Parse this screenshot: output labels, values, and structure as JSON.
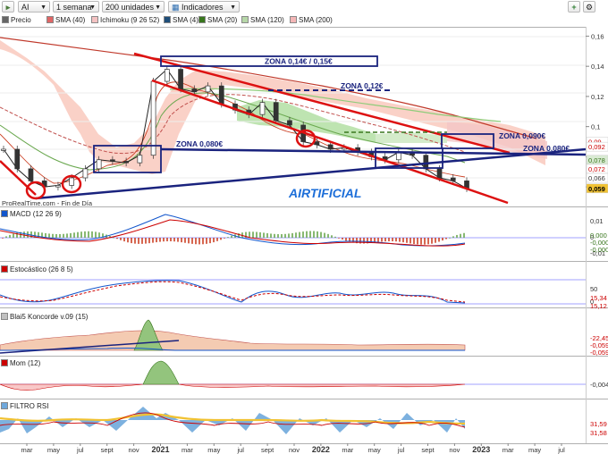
{
  "toolbar": {
    "symbol": "AI",
    "period": "1 semana",
    "units": "200 unidades",
    "indicators": "Indicadores"
  },
  "legend": [
    {
      "label": "Precio",
      "color": "#666666"
    },
    {
      "label": "SMA (40)",
      "color": "#e06666"
    },
    {
      "label": "Ichimoku (9 26 52)",
      "color": "#f4c2c2"
    },
    {
      "label": "SMA (4)",
      "color": "#1f4e79"
    },
    {
      "label": "SMA (20)",
      "color": "#38761d"
    },
    {
      "label": "SMA (120)",
      "color": "#b6d7a8"
    },
    {
      "label": "SMA (200)",
      "color": "#f4b6b6"
    }
  ],
  "annotations": {
    "zona_top": "ZONA 0,14€ / 0,15€",
    "zona_012": "ZONA 0,12€",
    "zona_080_left": "ZONA 0,080€",
    "zona_090": "ZONA 0,090€",
    "zona_080_right": "ZONA 0,080€",
    "watermark": "AIRTIFICIAL",
    "source": "ProRealTime.com - Fin de Día"
  },
  "price_axis": {
    "ticks": [
      "0,16",
      "0,14",
      "0,12",
      "0,1",
      "0,08",
      "0,06"
    ],
    "badges": [
      {
        "label": "0,09",
        "bg": "#ffffff",
        "fg": "#cc0000"
      },
      {
        "label": "0,092",
        "bg": "#ffffff",
        "fg": "#cc0000"
      },
      {
        "label": "0,078",
        "bg": "#d9ead3",
        "fg": "#38761d"
      },
      {
        "label": "0,072",
        "bg": "#ffffff",
        "fg": "#cc0000"
      },
      {
        "label": "0,066",
        "bg": "#ffffff",
        "fg": "#333333"
      },
      {
        "label": "0,059",
        "bg": "#f1c232",
        "fg": "#000000"
      }
    ]
  },
  "panels": {
    "macd": {
      "title": "MACD (12 26 9)",
      "ticks": [
        "0,01",
        "0",
        "-0,01"
      ],
      "badges": [
        "0,000",
        "-0,000",
        "-0,000"
      ]
    },
    "stoch": {
      "title": "Estocástico (26 8 5)",
      "ticks": [
        "50",
        "0"
      ],
      "badges": [
        "15,34",
        "15,12"
      ]
    },
    "koncorde": {
      "title": "Blai5 Koncorde v.09 (15)",
      "ticks": [],
      "badges": [
        "-22,45",
        "-0,059",
        "-0,059"
      ]
    },
    "mom": {
      "title": "Mom (12)",
      "ticks": [],
      "badges": [
        "-0,004"
      ]
    },
    "rsi": {
      "title": "FILTRO RSI",
      "ticks": [],
      "badges": [
        "31,59",
        "31,58"
      ]
    }
  },
  "time_axis": {
    "labels": [
      "mar",
      "may",
      "jul",
      "sept",
      "nov",
      "2021",
      "mar",
      "may",
      "jul",
      "sept",
      "nov",
      "2022",
      "mar",
      "may",
      "jul",
      "sept",
      "nov",
      "2023",
      "mar",
      "may",
      "jul"
    ],
    "bold": [
      "2021",
      "2022",
      "2023"
    ]
  },
  "chart_data": {
    "type": "line",
    "title": "",
    "ylim": [
      0.05,
      0.165
    ],
    "x": [
      "2020-02",
      "2020-03",
      "2020-04",
      "2020-05",
      "2020-06",
      "2020-07",
      "2020-08",
      "2020-09",
      "2020-10",
      "2020-11",
      "2020-12",
      "2021-01",
      "2021-02",
      "2021-03",
      "2021-04",
      "2021-05",
      "2021-06",
      "2021-07",
      "2021-08",
      "2021-09",
      "2021-10",
      "2021-11",
      "2021-12",
      "2022-01",
      "2022-02",
      "2022-03",
      "2022-04",
      "2022-05",
      "2022-06",
      "2022-07",
      "2022-08",
      "2022-09",
      "2022-10",
      "2022-11",
      "2022-12"
    ],
    "series": [
      {
        "name": "Precio",
        "values": [
          0.085,
          0.072,
          0.064,
          0.06,
          0.061,
          0.066,
          0.072,
          0.078,
          0.077,
          0.076,
          0.081,
          0.13,
          0.138,
          0.125,
          0.123,
          0.127,
          0.115,
          0.111,
          0.108,
          0.116,
          0.104,
          0.101,
          0.09,
          0.088,
          0.085,
          0.086,
          0.083,
          0.08,
          0.078,
          0.083,
          0.081,
          0.072,
          0.066,
          0.064,
          0.059
        ]
      }
    ]
  }
}
